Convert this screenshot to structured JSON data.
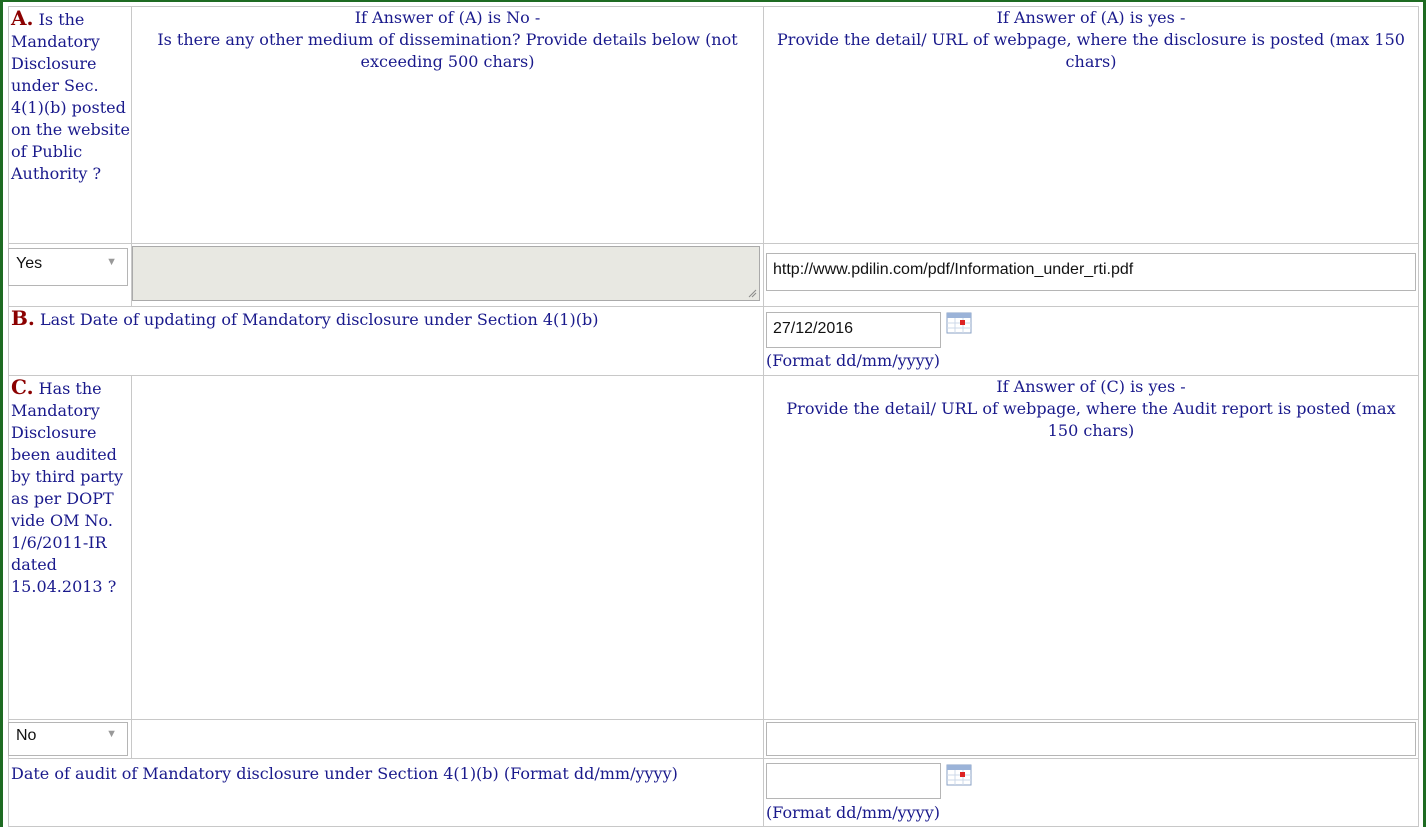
{
  "section_a": {
    "letter": "A.",
    "question": "Is the Mandatory Disclosure under Sec. 4(1)(b) posted on the website of Public Authority ?",
    "no_header_line1": "If Answer of (A) is No -",
    "no_header_line2": "Is there any other medium of dissemination? Provide details below (not exceeding 500 chars)",
    "yes_header_line1": "If Answer of (A) is yes -",
    "yes_header_line2": "Provide the detail/ URL of webpage, where the disclosure is posted (max 150 chars)",
    "answer": "Yes",
    "dissemination_details": "",
    "url": "http://www.pdilin.com/pdf/Information_under_rti.pdf"
  },
  "section_b": {
    "letter": "B.",
    "question": "Last Date of updating of Mandatory disclosure under Section 4(1)(b)",
    "date": "27/12/2016",
    "format_hint": "(Format dd/mm/yyyy)"
  },
  "section_c": {
    "letter": "C.",
    "question": "Has the Mandatory Disclosure been audited by third party as per DOPT vide OM No. 1/6/2011-IR dated 15.04.2013 ?",
    "yes_header_line1": "If Answer of (C) is yes -",
    "yes_header_line2": "Provide the detail/ URL of webpage, where the Audit report is posted (max 150 chars)",
    "answer": "No",
    "middle_value": "",
    "url": ""
  },
  "audit_date": {
    "question": "Date of audit of Mandatory disclosure under Section 4(1)(b) (Format dd/mm/yyyy)",
    "date": "",
    "format_hint": "(Format dd/mm/yyyy)"
  },
  "icons": {
    "calendar": "calendar-icon",
    "dropdown": "chevron-down-icon",
    "resize": "resize-grip-icon"
  },
  "colors": {
    "border_green": "#1e6b22",
    "label_red": "#8b0000",
    "text_blue": "#1a1a8c"
  }
}
